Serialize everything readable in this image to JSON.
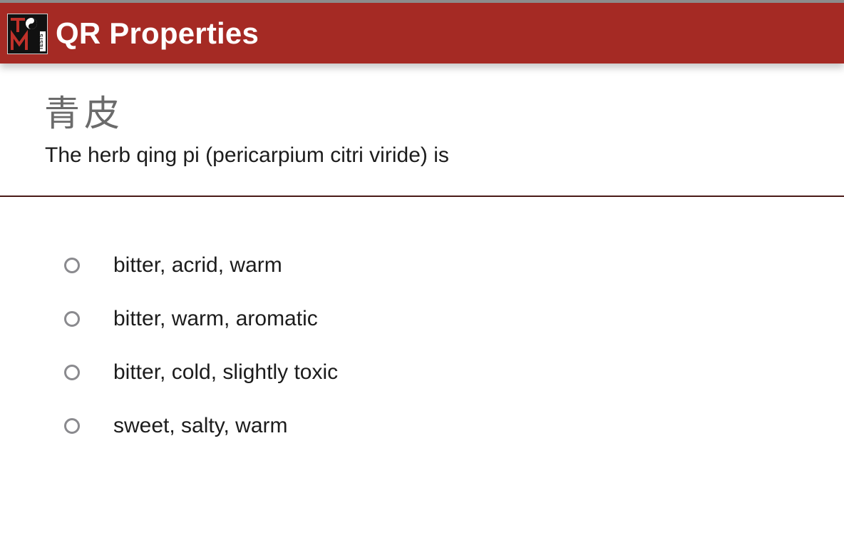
{
  "header": {
    "logo_text": "TCM TESTS",
    "title": "QR Properties",
    "background_color": "#a52a24"
  },
  "question": {
    "chinese_name": "青皮",
    "text": "The herb qing pi (pericarpium citri viride) is"
  },
  "options": [
    {
      "label": "bitter, acrid, warm",
      "selected": false
    },
    {
      "label": "bitter, warm, aromatic",
      "selected": false
    },
    {
      "label": "bitter, cold, slightly toxic",
      "selected": false
    },
    {
      "label": "sweet, salty, warm",
      "selected": false
    }
  ]
}
